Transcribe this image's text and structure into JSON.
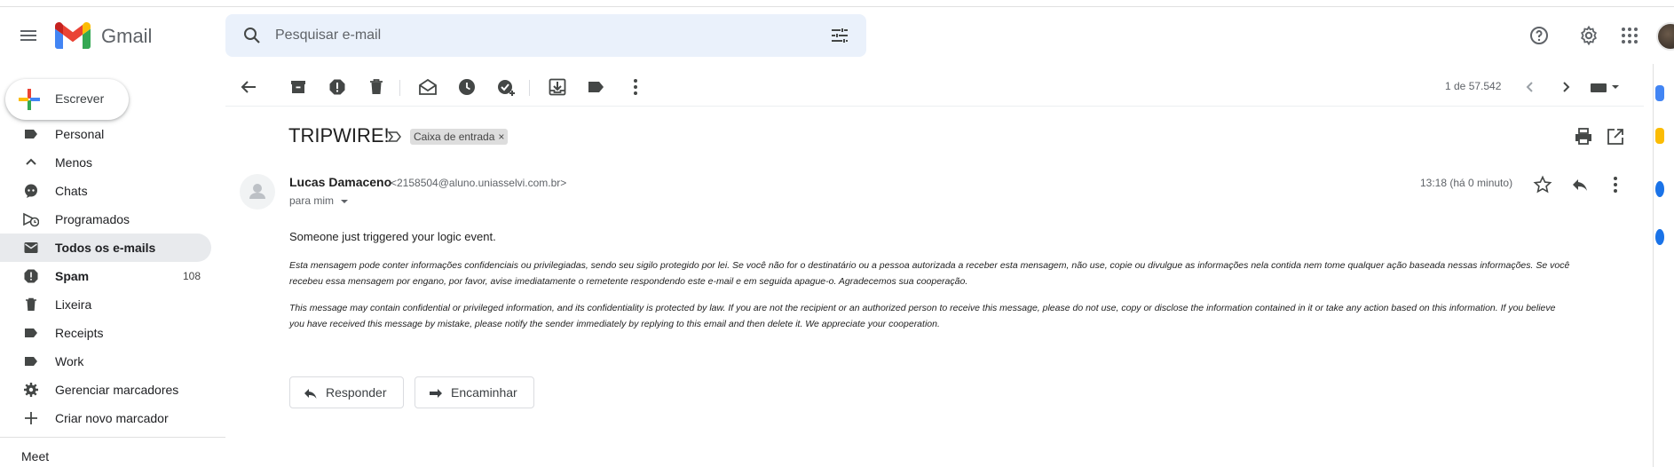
{
  "app": {
    "name": "Gmail"
  },
  "search": {
    "placeholder": "Pesquisar e-mail"
  },
  "compose": {
    "label": "Escrever"
  },
  "sidebar": {
    "items": [
      {
        "label": "Personal",
        "icon": "label-icon",
        "count": ""
      },
      {
        "label": "Menos",
        "icon": "chevron-up-icon",
        "count": ""
      },
      {
        "label": "Chats",
        "icon": "chat-icon",
        "count": ""
      },
      {
        "label": "Programados",
        "icon": "scheduled-send-icon",
        "count": ""
      },
      {
        "label": "Todos os e-mails",
        "icon": "all-mail-icon",
        "count": ""
      },
      {
        "label": "Spam",
        "icon": "spam-icon",
        "count": "108"
      },
      {
        "label": "Lixeira",
        "icon": "trash-icon",
        "count": ""
      },
      {
        "label": "Receipts",
        "icon": "label-icon",
        "count": ""
      },
      {
        "label": "Work",
        "icon": "label-icon",
        "count": ""
      },
      {
        "label": "Gerenciar marcadores",
        "icon": "gear-icon",
        "count": ""
      },
      {
        "label": "Criar novo marcador",
        "icon": "plus-icon",
        "count": ""
      }
    ],
    "meet": "Meet"
  },
  "toolbar": {
    "pager": "1 de 57.542"
  },
  "message": {
    "subject": "TRIPWIRE!",
    "label_chip": "Caixa de entrada",
    "sender_name": "Lucas Damaceno",
    "sender_email": "<2158504@aluno.uniasselvi.com.br>",
    "to": "para mim",
    "time": "13:18 (há 0 minuto)",
    "body": "Someone just triggered your logic event.",
    "disclaimer_pt_line1": "Esta mensagem pode conter informações confidenciais ou privilegiadas, sendo seu sigilo protegido por lei. Se você não for o destinatário ou a pessoa autorizada a receber esta mensagem, não use, copie ou divulgue as informações nela contida nem tome qualquer ação baseada nessas informações. Se você",
    "disclaimer_pt_line2": "recebeu essa mensagem por engano, por favor, avise imediatamente o remetente respondendo este e-mail e em seguida apague-o. Agradecemos sua cooperação.",
    "disclaimer_en_line1": "This message may contain confidential or privileged information, and its confidentiality is protected by law. If you are not the recipient or an authorized person to receive this message, please do not use, copy or disclose the information contained in it or take any action based on this information. If you believe",
    "disclaimer_en_line2": "you have received this message by mistake, please notify the sender immediately by replying to this email and then delete it. We appreciate your cooperation.",
    "reply_label": "Responder",
    "forward_label": "Encaminhar"
  }
}
